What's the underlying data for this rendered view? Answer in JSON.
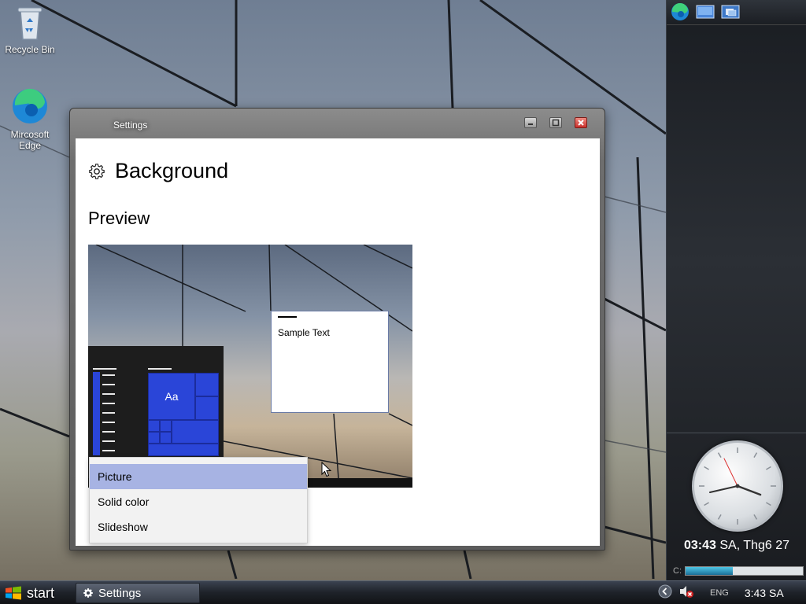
{
  "desktop": {
    "icons": [
      {
        "label": "Recycle Bin",
        "icon": "recycle-bin-icon"
      },
      {
        "label": "Mircosoft\nEdge",
        "icon": "edge-icon"
      }
    ]
  },
  "sidebar": {
    "top_icons": [
      "edge-icon",
      "desktop-icon",
      "window-switch-icon"
    ],
    "clock_text_bold": "03:43",
    "clock_text_rest": " SA, Thg6 27",
    "drive_label": "C:",
    "drive_used_fraction": 0.4
  },
  "window": {
    "title": "Settings",
    "page_title": "Background",
    "section_title": "Preview",
    "preview": {
      "sample_text": "Sample Text",
      "tile_text": "Aa"
    },
    "dropdown": {
      "options": [
        "Picture",
        "Solid color",
        "Slideshow"
      ],
      "selected_index": 0
    }
  },
  "taskbar": {
    "start_label": "start",
    "items": [
      {
        "label": "Settings",
        "icon": "gear-icon"
      }
    ],
    "language": "ENG",
    "time": "3:43 SA"
  },
  "colors": {
    "accent": "#2a45d8",
    "selection": "#a7b3e3"
  }
}
